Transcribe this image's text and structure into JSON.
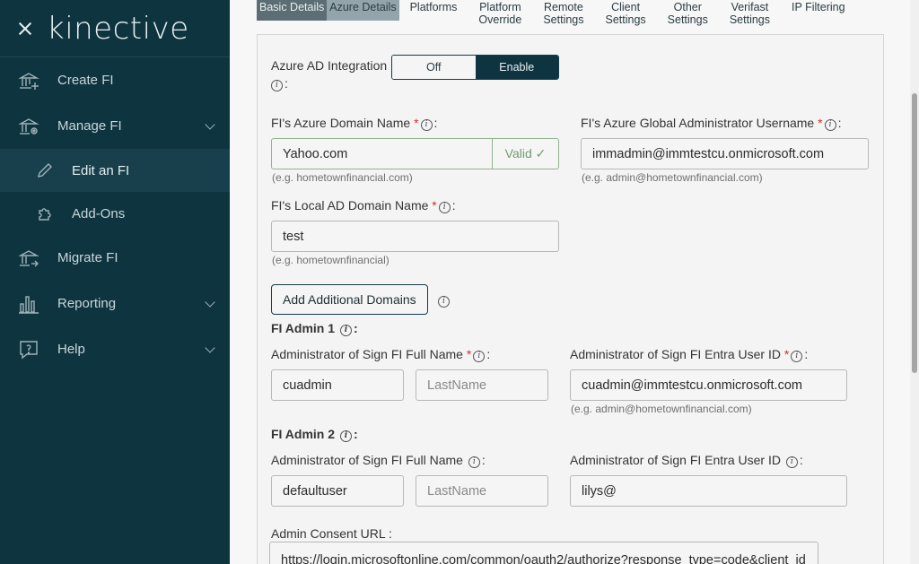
{
  "sidebar": {
    "logo": "kinective",
    "items": [
      {
        "label": "Create FI"
      },
      {
        "label": "Manage FI"
      },
      {
        "label": "Edit an FI"
      },
      {
        "label": "Add-Ons"
      },
      {
        "label": "Migrate FI"
      },
      {
        "label": "Reporting"
      },
      {
        "label": "Help"
      }
    ]
  },
  "tabs": [
    {
      "line1": "Basic Details",
      "line2": ""
    },
    {
      "line1": "Azure Details",
      "line2": ""
    },
    {
      "line1": "Platforms",
      "line2": ""
    },
    {
      "line1": "Platform",
      "line2": "Override"
    },
    {
      "line1": "Remote",
      "line2": "Settings"
    },
    {
      "line1": "Client",
      "line2": "Settings"
    },
    {
      "line1": "Other",
      "line2": "Settings"
    },
    {
      "line1": "Verifast",
      "line2": "Settings"
    },
    {
      "line1": "IP Filtering",
      "line2": ""
    }
  ],
  "form": {
    "azure_ad": {
      "label": "Azure AD Integration",
      "colon": ":",
      "off": "Off",
      "enable": "Enable"
    },
    "azure_domain": {
      "label": "FI's Azure Domain Name",
      "value": "Yahoo.com",
      "valid": "Valid ✓",
      "hint": "(e.g. hometownfinancial.com)"
    },
    "global_admin": {
      "label": "FI's Azure Global Administrator Username",
      "value": "immadmin@immtestcu.onmicrosoft.com",
      "hint": "(e.g. admin@hometownfinancial.com)"
    },
    "local_domain": {
      "label": "FI's Local AD Domain Name",
      "value": "test",
      "hint": "(e.g. hometownfinancial)"
    },
    "add_domains": "Add Additional Domains",
    "admin1": {
      "title": "FI Admin 1",
      "name_label": "Administrator of Sign FI Full Name",
      "first": "cuadmin",
      "last_placeholder": "LastName",
      "entra_label": "Administrator of Sign FI Entra User ID",
      "entra": "cuadmin@immtestcu.onmicrosoft.com",
      "hint": "(e.g. admin@hometownfinancial.com)"
    },
    "admin2": {
      "title": "FI Admin 2",
      "name_label": "Administrator of Sign FI Full Name",
      "first": "defaultuser",
      "last_placeholder": "LastName",
      "entra_label": "Administrator of Sign FI Entra User ID",
      "entra": "lilys@"
    },
    "consent": {
      "label": "Admin Consent URL :",
      "value": "https://login.microsoftonline.com/common/oauth2/authorize?response_type=code&client_id"
    }
  }
}
